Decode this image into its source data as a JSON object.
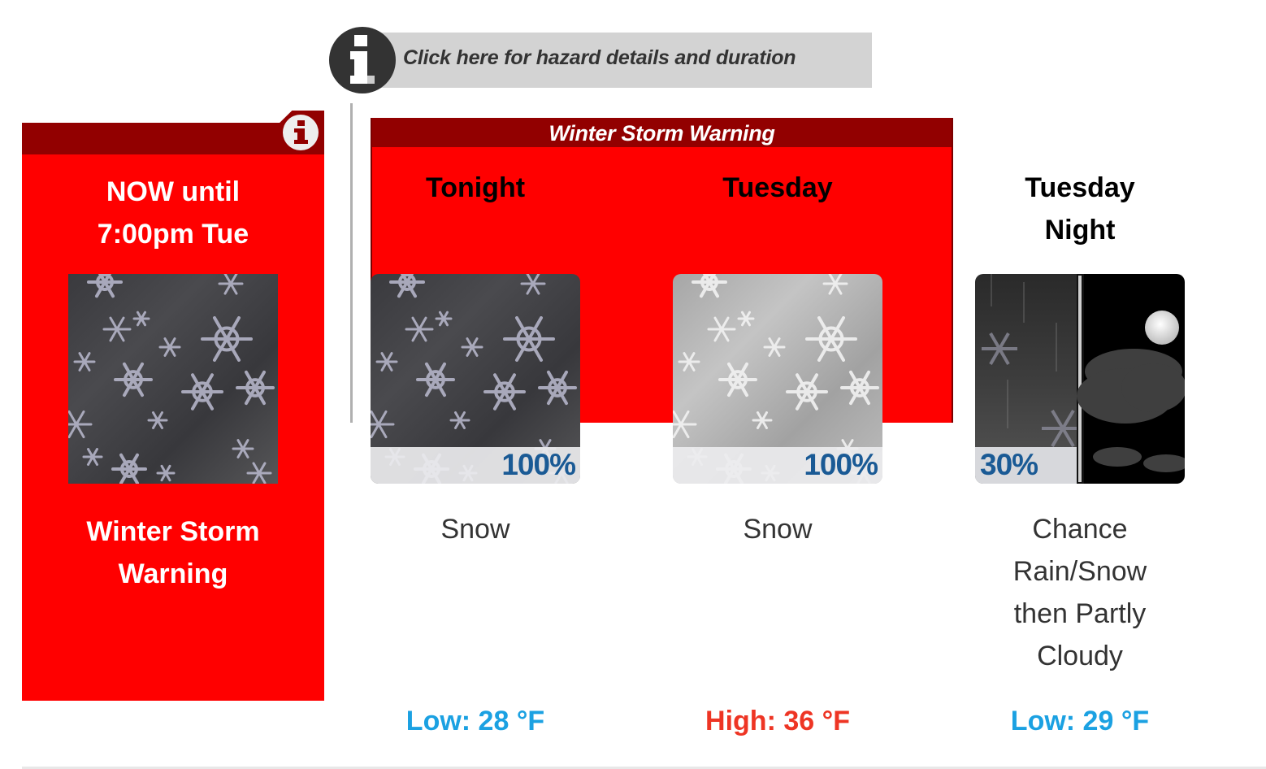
{
  "hazard_banner": {
    "icon": "info-icon",
    "label": "Click here for hazard details and duration"
  },
  "current_warning": {
    "icon": "info-icon",
    "until_line1": "NOW until",
    "until_line2": "7:00pm Tue",
    "image": "snow-icon",
    "title_line1": "Winter Storm",
    "title_line2": "Warning"
  },
  "storm_band": {
    "label": "Winter Storm Warning"
  },
  "periods": [
    {
      "name_line1": "Tonight",
      "name_line2": "",
      "image": "snow-icon",
      "pop": "100%",
      "desc_lines": [
        "Snow"
      ],
      "temp": "Low: 28 °F",
      "temp_type": "low"
    },
    {
      "name_line1": "Tuesday",
      "name_line2": "",
      "image": "snow-day-icon",
      "pop": "100%",
      "desc_lines": [
        "Snow"
      ],
      "temp": "High: 36 °F",
      "temp_type": "high"
    },
    {
      "name_line1": "Tuesday",
      "name_line2": "Night",
      "image": "rain-snow-then-partly-cloudy-night-icon",
      "pop": "30%",
      "desc_lines": [
        "Chance",
        "Rain/Snow",
        "then Partly",
        "Cloudy"
      ],
      "temp": "Low: 29 °F",
      "temp_type": "low"
    }
  ],
  "colors": {
    "warning_red": "#ff0000",
    "warning_dark_red": "#920000",
    "low_temp": "#1ba1e2",
    "high_temp": "#ee3524",
    "pop_text": "#1a5a95"
  }
}
